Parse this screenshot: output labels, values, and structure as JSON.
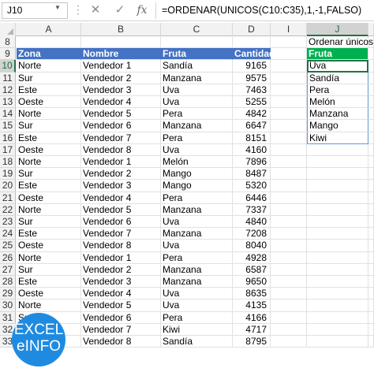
{
  "formula_bar": {
    "name_box": "J10",
    "name_box_arrow": "▼",
    "dots": "⋮",
    "cancel_icon": "✕",
    "enter_icon": "✓",
    "fx_label": "fx",
    "formula": "=ORDENAR(UNICOS(C10:C35),1,-1,FALSO)"
  },
  "columns": [
    "A",
    "B",
    "C",
    "D",
    "I",
    "J"
  ],
  "selected_column": "J",
  "selected_row": "10",
  "header_row": {
    "row": "9",
    "zona": "Zona",
    "nombre": "Nombre",
    "fruta": "Fruta",
    "cantidad": "Cantidad"
  },
  "row8": {
    "row": "8",
    "j": "Ordenar únicos"
  },
  "row9_j": "Fruta",
  "rows": [
    {
      "row": "10",
      "zona": "Norte",
      "nombre": "Vendedor 1",
      "fruta": "Sandía",
      "cantidad": "9165",
      "j": "Uva"
    },
    {
      "row": "11",
      "zona": "Sur",
      "nombre": "Vendedor 2",
      "fruta": "Manzana",
      "cantidad": "9575",
      "j": "Sandía"
    },
    {
      "row": "12",
      "zona": "Este",
      "nombre": "Vendedor 3",
      "fruta": "Uva",
      "cantidad": "7463",
      "j": "Pera"
    },
    {
      "row": "13",
      "zona": "Oeste",
      "nombre": "Vendedor 4",
      "fruta": "Uva",
      "cantidad": "5255",
      "j": "Melón"
    },
    {
      "row": "14",
      "zona": "Norte",
      "nombre": "Vendedor 5",
      "fruta": "Pera",
      "cantidad": "4842",
      "j": "Manzana"
    },
    {
      "row": "15",
      "zona": "Sur",
      "nombre": "Vendedor 6",
      "fruta": "Manzana",
      "cantidad": "6647",
      "j": "Mango"
    },
    {
      "row": "16",
      "zona": "Este",
      "nombre": "Vendedor 7",
      "fruta": "Pera",
      "cantidad": "8151",
      "j": "Kiwi"
    },
    {
      "row": "17",
      "zona": "Oeste",
      "nombre": "Vendedor 8",
      "fruta": "Uva",
      "cantidad": "4160",
      "j": ""
    },
    {
      "row": "18",
      "zona": "Norte",
      "nombre": "Vendedor 1",
      "fruta": "Melón",
      "cantidad": "7896",
      "j": ""
    },
    {
      "row": "19",
      "zona": "Sur",
      "nombre": "Vendedor 2",
      "fruta": "Mango",
      "cantidad": "8487",
      "j": ""
    },
    {
      "row": "20",
      "zona": "Este",
      "nombre": "Vendedor 3",
      "fruta": "Mango",
      "cantidad": "5320",
      "j": ""
    },
    {
      "row": "21",
      "zona": "Oeste",
      "nombre": "Vendedor 4",
      "fruta": "Pera",
      "cantidad": "6446",
      "j": ""
    },
    {
      "row": "22",
      "zona": "Norte",
      "nombre": "Vendedor 5",
      "fruta": "Manzana",
      "cantidad": "7337",
      "j": ""
    },
    {
      "row": "23",
      "zona": "Sur",
      "nombre": "Vendedor 6",
      "fruta": "Uva",
      "cantidad": "4840",
      "j": ""
    },
    {
      "row": "24",
      "zona": "Este",
      "nombre": "Vendedor 7",
      "fruta": "Manzana",
      "cantidad": "7208",
      "j": ""
    },
    {
      "row": "25",
      "zona": "Oeste",
      "nombre": "Vendedor 8",
      "fruta": "Uva",
      "cantidad": "8040",
      "j": ""
    },
    {
      "row": "26",
      "zona": "Norte",
      "nombre": "Vendedor 1",
      "fruta": "Pera",
      "cantidad": "4928",
      "j": ""
    },
    {
      "row": "27",
      "zona": "Sur",
      "nombre": "Vendedor 2",
      "fruta": "Manzana",
      "cantidad": "6587",
      "j": ""
    },
    {
      "row": "28",
      "zona": "Este",
      "nombre": "Vendedor 3",
      "fruta": "Manzana",
      "cantidad": "9650",
      "j": ""
    },
    {
      "row": "29",
      "zona": "Oeste",
      "nombre": "Vendedor 4",
      "fruta": "Uva",
      "cantidad": "8635",
      "j": ""
    },
    {
      "row": "30",
      "zona": "Norte",
      "nombre": "Vendedor 5",
      "fruta": "Uva",
      "cantidad": "4135",
      "j": ""
    },
    {
      "row": "31",
      "zona": "Sur",
      "nombre": "Vendedor 6",
      "fruta": "Pera",
      "cantidad": "4166",
      "j": ""
    },
    {
      "row": "32",
      "zona": "Este",
      "nombre": "Vendedor 7",
      "fruta": "Kiwi",
      "cantidad": "4717",
      "j": ""
    },
    {
      "row": "33",
      "zona": "Oeste",
      "nombre": "Vendedor 8",
      "fruta": "Sandía",
      "cantidad": "8795",
      "j": ""
    }
  ],
  "logo": {
    "line1": "EXCEL",
    "line2": "eINFO"
  }
}
